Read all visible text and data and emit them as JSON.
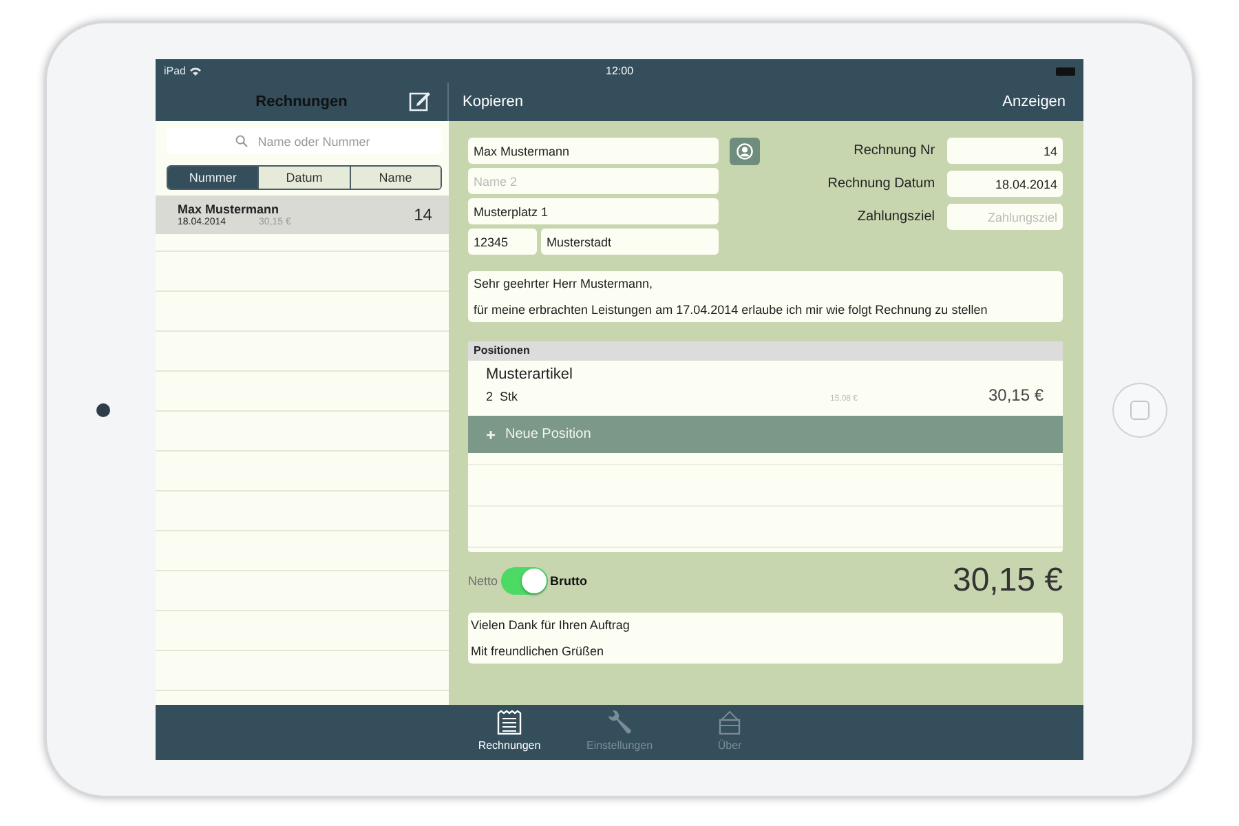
{
  "status_bar": {
    "device": "iPad",
    "time": "12:00"
  },
  "nav_bar": {
    "left_title": "Rechnungen",
    "left_action": "Kopieren",
    "right_action": "Anzeigen"
  },
  "sidebar": {
    "search": {
      "placeholder": "Name oder Nummer"
    },
    "sort_tabs": [
      {
        "label": "Nummer",
        "selected": true
      },
      {
        "label": "Datum",
        "selected": false
      },
      {
        "label": "Name",
        "selected": false
      }
    ],
    "items": [
      {
        "name": "Max Mustermann",
        "date": "18.04.2014",
        "amount": "30,15 €",
        "number": "14",
        "selected": true
      }
    ]
  },
  "customer": {
    "name": "Max Mustermann",
    "name2": {
      "placeholder": "Name 2"
    },
    "street": "Musterplatz 1",
    "zip": "12345",
    "city": "Musterstadt"
  },
  "invoice_fields": [
    {
      "label": "Rechnung Nr",
      "value": "14"
    },
    {
      "label": "Rechnung Datum",
      "value": "18.04.2014"
    },
    {
      "label": "Zahlungsziel",
      "placeholder": "Zahlungsziel"
    }
  ],
  "intro": [
    "Sehr geehrter Herr Mustermann,",
    "für meine erbrachten Leistungen am 17.04.2014 erlaube ich mir wie folgt Rechnung zu stellen"
  ],
  "positions": {
    "header": "Positionen",
    "items": [
      {
        "name": "Musterartikel",
        "quantity": "2",
        "unit": "Stk",
        "unit_price": "15,08 €",
        "total": "30,15 €"
      }
    ],
    "add_button": {
      "icon": "+",
      "label": "Neue Position"
    }
  },
  "total": {
    "netto_label": "Netto",
    "brutto_label": "Brutto",
    "brutto": true,
    "amount": "30,15 €"
  },
  "closing": [
    "Vielen Dank für Ihren Auftrag",
    "Mit freundlichen Grüßen"
  ],
  "tab_bar": [
    {
      "kind": "list",
      "label": "Rechnungen",
      "selected": true
    },
    {
      "kind": "wrench",
      "label": "Einstellungen",
      "selected": false
    },
    {
      "kind": "box",
      "label": "Über",
      "selected": false
    }
  ]
}
